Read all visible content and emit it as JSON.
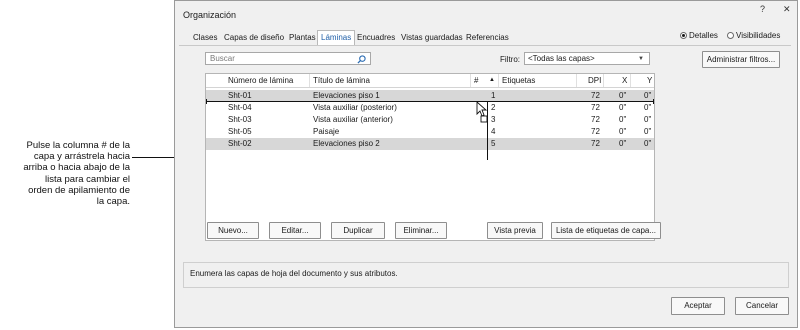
{
  "callout": {
    "lines": [
      "Pulse la columna # de la",
      "capa y arrástrela hacia",
      "arriba o hacia abajo de la",
      "lista para cambiar el",
      "orden de apilamiento de",
      "la capa."
    ]
  },
  "dialog": {
    "title": "Organización",
    "help_label": "?",
    "close_label": "✕"
  },
  "tabs": [
    {
      "label": "Clases",
      "active": false
    },
    {
      "label": "Capas de diseño",
      "active": false
    },
    {
      "label": "Plantas",
      "active": false
    },
    {
      "label": "Láminas",
      "active": true
    },
    {
      "label": "Encuadres",
      "active": false
    },
    {
      "label": "Vistas guardadas",
      "active": false
    },
    {
      "label": "Referencias",
      "active": false
    }
  ],
  "view_mode": {
    "details_label": "Detalles",
    "visibilities_label": "Visibilidades",
    "selected": "Detalles"
  },
  "search": {
    "placeholder": "Buscar",
    "icon": "search-icon"
  },
  "filter": {
    "label": "Filtro:",
    "value": "<Todas las capas>",
    "manage_label": "Administrar filtros..."
  },
  "table": {
    "columns": [
      "Número de lámina",
      "Título de lámina",
      "#",
      "Etiquetas",
      "DPI",
      "X",
      "Y"
    ],
    "sort_indicator": "▲",
    "rows": [
      {
        "num": "Sht-01",
        "title": "Elevaciones piso 1",
        "order": "1",
        "tags": "",
        "dpi": "72",
        "x": "0\"",
        "y": "0\"",
        "selected": true
      },
      {
        "num": "Sht-04",
        "title": "Vista auxiliar (posterior)",
        "order": "2",
        "tags": "",
        "dpi": "72",
        "x": "0\"",
        "y": "0\"",
        "selected": false
      },
      {
        "num": "Sht-03",
        "title": "Vista auxiliar (anterior)",
        "order": "3",
        "tags": "",
        "dpi": "72",
        "x": "0\"",
        "y": "0\"",
        "selected": false
      },
      {
        "num": "Sht-05",
        "title": "Paisaje",
        "order": "4",
        "tags": "",
        "dpi": "72",
        "x": "0\"",
        "y": "0\"",
        "selected": false
      },
      {
        "num": "Sht-02",
        "title": "Elevaciones piso 2",
        "order": "5",
        "tags": "",
        "dpi": "72",
        "x": "0\"",
        "y": "0\"",
        "selected": true
      }
    ]
  },
  "buttons": {
    "new": "Nuevo...",
    "edit": "Editar...",
    "duplicate": "Duplicar",
    "delete": "Eliminar...",
    "preview": "Vista previa",
    "tags_list": "Lista de etiquetas de capa...",
    "accept": "Aceptar",
    "cancel": "Cancelar"
  },
  "description": "Enumera las capas de hoja del documento y sus atributos."
}
